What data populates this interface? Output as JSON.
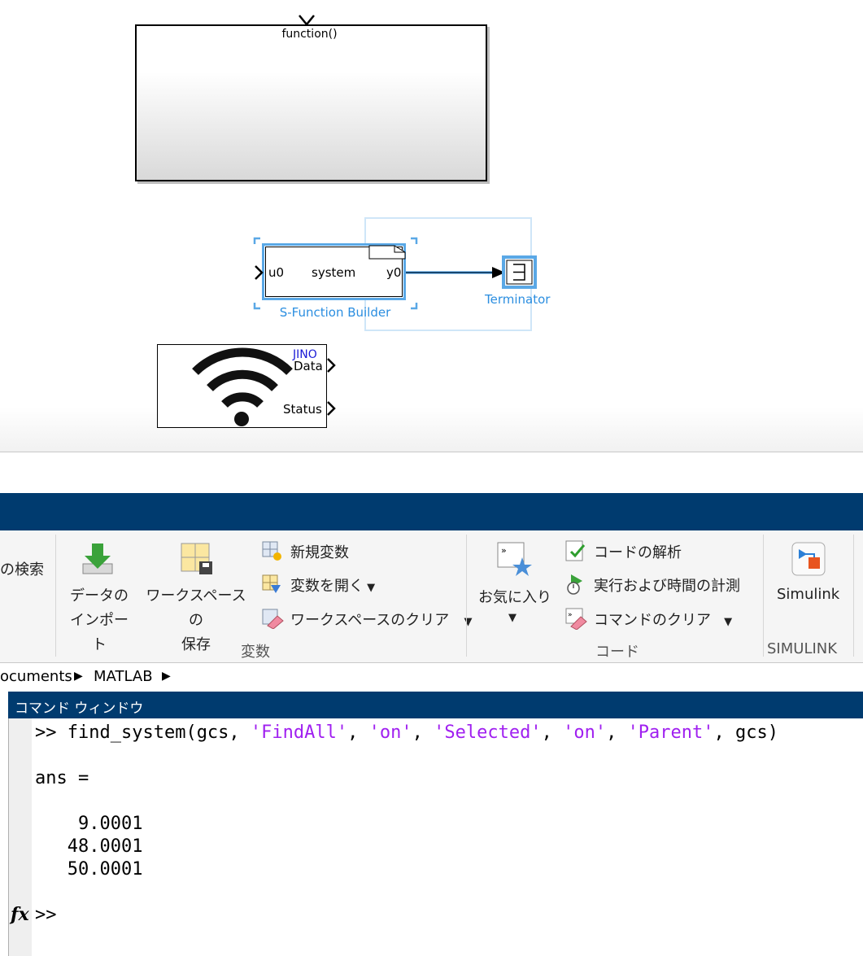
{
  "simulink": {
    "function_block": {
      "label": "function()"
    },
    "sfunction_block": {
      "input_port": "u0",
      "system_label": "system",
      "output_port": "y0",
      "name": "S-Function Builder"
    },
    "terminator_block": {
      "name": "Terminator"
    },
    "wifi_block": {
      "tag": "JINO",
      "port_data": "Data",
      "port_status": "Status"
    }
  },
  "ribbon": {
    "search_partial": "の検索",
    "import_data": {
      "line1": "データの",
      "line2": "インポート"
    },
    "save_workspace": {
      "line1": "ワークスペースの",
      "line2": "保存"
    },
    "new_variable": "新規変数",
    "open_variable": "変数を開く",
    "clear_workspace": "ワークスペースのクリア",
    "variable_section": "変数",
    "favorites": "お気に入り",
    "analyze_code": "コードの解析",
    "run_and_time": "実行および時間の計測",
    "clear_commands": "コマンドのクリア",
    "code_section": "コード",
    "simulink_button": "Simulink",
    "simulink_section": "SIMULINK"
  },
  "path": {
    "part1": "ocuments",
    "part2": "MATLAB"
  },
  "command_window": {
    "title": "コマンド ウィンドウ",
    "prompt": ">>",
    "cmd_fn": "find_system(gcs, ",
    "arg1": "'FindAll'",
    "arg2": "'on'",
    "arg3": "'Selected'",
    "arg4": "'on'",
    "arg5": "'Parent'",
    "cmd_end": ", gcs)",
    "sep": ", ",
    "ans_line": "ans =",
    "values": [
      "    9.0001",
      "   48.0001",
      "   50.0001"
    ],
    "fx": "fx"
  }
}
